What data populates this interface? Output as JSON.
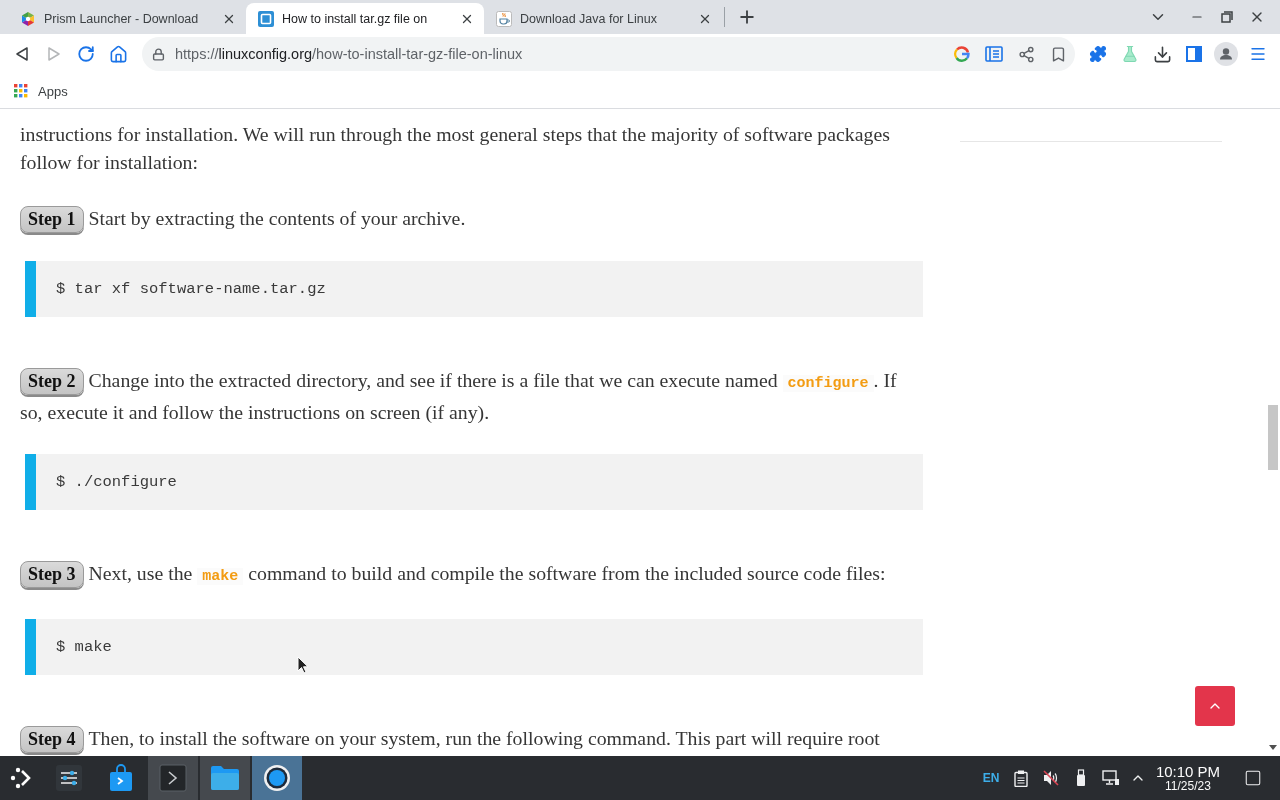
{
  "browser": {
    "tabs": [
      {
        "kind": "hexagon",
        "title": "Prism Launcher - Download",
        "selected": false
      },
      {
        "kind": "tile",
        "title": "How to install tar.gz file on",
        "selected": true
      },
      {
        "kind": "cup",
        "title": "Download Java for Linux",
        "selected": false
      }
    ],
    "nav_buttons": [
      {
        "kind": "back",
        "disabled": false
      },
      {
        "kind": "forward",
        "disabled": true
      },
      {
        "kind": "reload",
        "disabled": false
      },
      {
        "kind": "home",
        "disabled": false
      }
    ],
    "address_bar": {
      "scheme": "https://",
      "domain": "linuxconfig.org",
      "path": "/how-to-install-tar-gz-file-on-linux"
    },
    "bookmarks": [
      {
        "label": "Apps"
      }
    ]
  },
  "article": {
    "intro": "instructions for installation. We will run through the most general steps that the majority of software packages follow for installation:",
    "steps": [
      {
        "badge": "Step 1",
        "parts": [
          {
            "kind": "text",
            "text": "Start by extracting the contents of your archive."
          }
        ],
        "command": "$ tar xf software-name.tar.gz"
      },
      {
        "badge": "Step 2",
        "parts": [
          {
            "kind": "text",
            "text": "Change into the extracted directory, and see if there is a file that we can execute named "
          },
          {
            "kind": "code",
            "text": "configure"
          },
          {
            "kind": "text",
            "text": ". If so, execute it and follow the instructions on screen (if any)."
          }
        ],
        "command": "$ ./configure"
      },
      {
        "badge": "Step 3",
        "parts": [
          {
            "kind": "text",
            "text": "Next, use the "
          },
          {
            "kind": "code",
            "text": "make"
          },
          {
            "kind": "text",
            "text": " command to build and compile the software from the included source code files:"
          }
        ],
        "command": "$ make"
      },
      {
        "badge": "Step 4",
        "parts": [
          {
            "kind": "text",
            "text": "Then, to install the software on your system, run the following command. This part will require root"
          }
        ]
      }
    ]
  },
  "taskbar": {
    "apps": [
      {
        "kind": "settings",
        "open": false,
        "selected": false
      },
      {
        "kind": "store",
        "open": false,
        "selected": false
      },
      {
        "kind": "terminal",
        "open": true,
        "selected": false
      },
      {
        "kind": "files",
        "open": true,
        "selected": false
      },
      {
        "kind": "browser",
        "open": true,
        "selected": true
      }
    ],
    "tray": {
      "keyboard_layout": "EN",
      "muted": true
    },
    "clock": {
      "time": "10:10 PM",
      "date": "11/25/23"
    }
  }
}
